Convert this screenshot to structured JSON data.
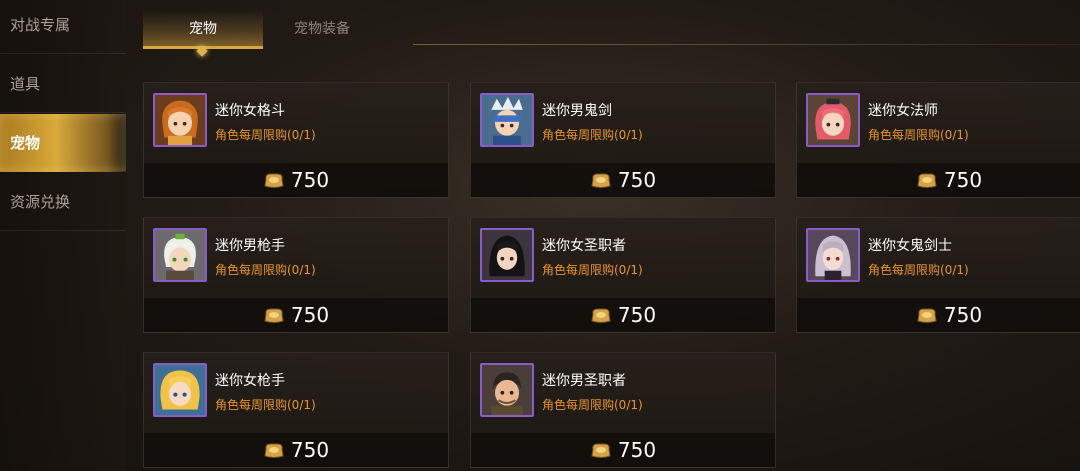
{
  "sidebar": {
    "items": [
      {
        "label": "对战专属"
      },
      {
        "label": "道具"
      },
      {
        "label": "宠物",
        "active": true
      },
      {
        "label": "资源兑换"
      }
    ]
  },
  "tabs": [
    {
      "label": "宠物",
      "active": true
    },
    {
      "label": "宠物装备"
    }
  ],
  "currency_icon": "gold-coin-pouch-icon",
  "colors": {
    "accent": "#d7a83c",
    "limit_text": "#e8942c",
    "avatar_border": "#8a5cc9"
  },
  "pets": [
    {
      "name": "迷你女格斗",
      "limit": "角色每周限购(0/1)",
      "price": "750",
      "portrait": "female-fighter-portrait-icon"
    },
    {
      "name": "迷你男鬼剑",
      "limit": "角色每周限购(0/1)",
      "price": "750",
      "portrait": "male-slayer-portrait-icon"
    },
    {
      "name": "迷你女法师",
      "limit": "角色每周限购(0/1)",
      "price": "750",
      "portrait": "female-mage-portrait-icon"
    },
    {
      "name": "迷你男枪手",
      "limit": "角色每周限购(0/1)",
      "price": "750",
      "portrait": "male-gunner-portrait-icon"
    },
    {
      "name": "迷你女圣职者",
      "limit": "角色每周限购(0/1)",
      "price": "750",
      "portrait": "female-priest-portrait-icon"
    },
    {
      "name": "迷你女鬼剑士",
      "limit": "角色每周限购(0/1)",
      "price": "750",
      "portrait": "female-slayer-portrait-icon"
    },
    {
      "name": "迷你女枪手",
      "limit": "角色每周限购(0/1)",
      "price": "750",
      "portrait": "female-gunner-portrait-icon"
    },
    {
      "name": "迷你男圣职者",
      "limit": "角色每周限购(0/1)",
      "price": "750",
      "portrait": "male-priest-portrait-icon"
    }
  ]
}
